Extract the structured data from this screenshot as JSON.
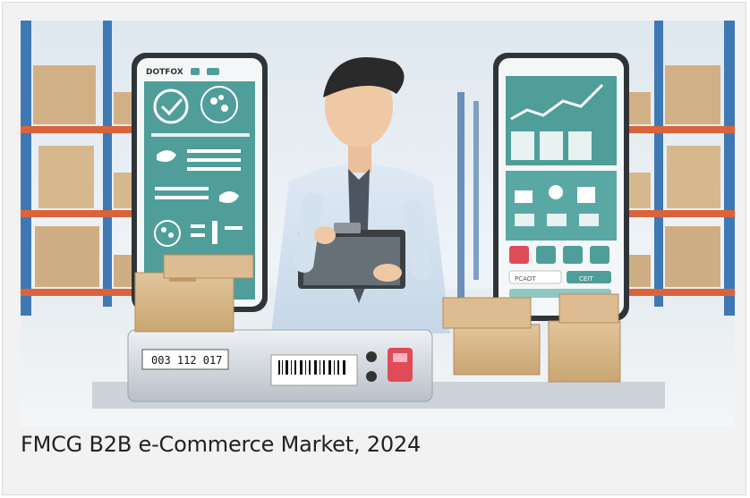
{
  "card": {
    "caption": "FMCG B2B e-Commerce Market, 2024"
  },
  "illustration": {
    "left_phone_brand": "DOTFOX",
    "left_phone_field": "PCAOT",
    "right_phone_button": "CEIT",
    "scanner_display": "003 112 017",
    "colors": {
      "accent_teal": "#4f9e9a",
      "shelf_orange": "#d9643c",
      "shelf_blue": "#3f79b3",
      "cardboard": "#d8b98d",
      "scanner_red": "#e04b5a"
    },
    "icons": [
      "checkmark-icon",
      "settings-gear-icon",
      "twitter-bird-icon",
      "chart-icon",
      "person-icon",
      "key-icon",
      "check-icon",
      "user-icon"
    ]
  }
}
